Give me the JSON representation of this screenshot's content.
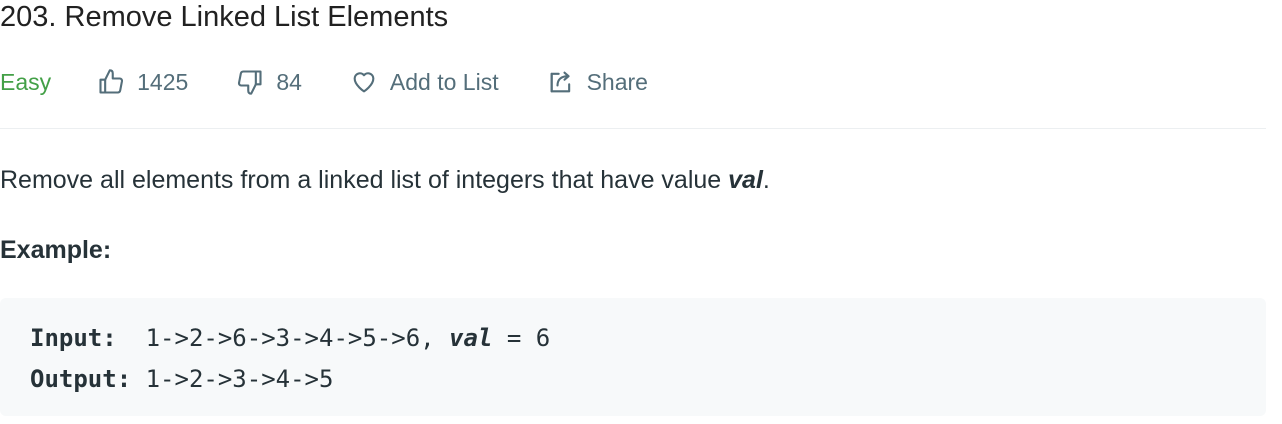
{
  "problem": {
    "title": "203. Remove Linked List Elements",
    "difficulty": "Easy",
    "likes": "1425",
    "dislikes": "84",
    "add_to_list_label": "Add to List",
    "share_label": "Share"
  },
  "description": {
    "text_before": "Remove all elements from a linked list of integers that have value ",
    "emphasis": "val",
    "text_after": "."
  },
  "example": {
    "heading": "Example:",
    "input_label": "Input:",
    "input_value": "  1->2->6->3->4->5->6,",
    "input_val_keyword": "val",
    "input_val_rest": " = 6",
    "output_label": "Output:",
    "output_value": " 1->2->3->4->5"
  },
  "colors": {
    "difficulty_easy": "#43a047",
    "meta_text": "#546e7a",
    "code_background": "#f7f9fa"
  },
  "icons": {
    "likes": "thumbs-up-icon",
    "dislikes": "thumbs-down-icon",
    "add_to_list": "heart-icon",
    "share": "share-icon"
  }
}
